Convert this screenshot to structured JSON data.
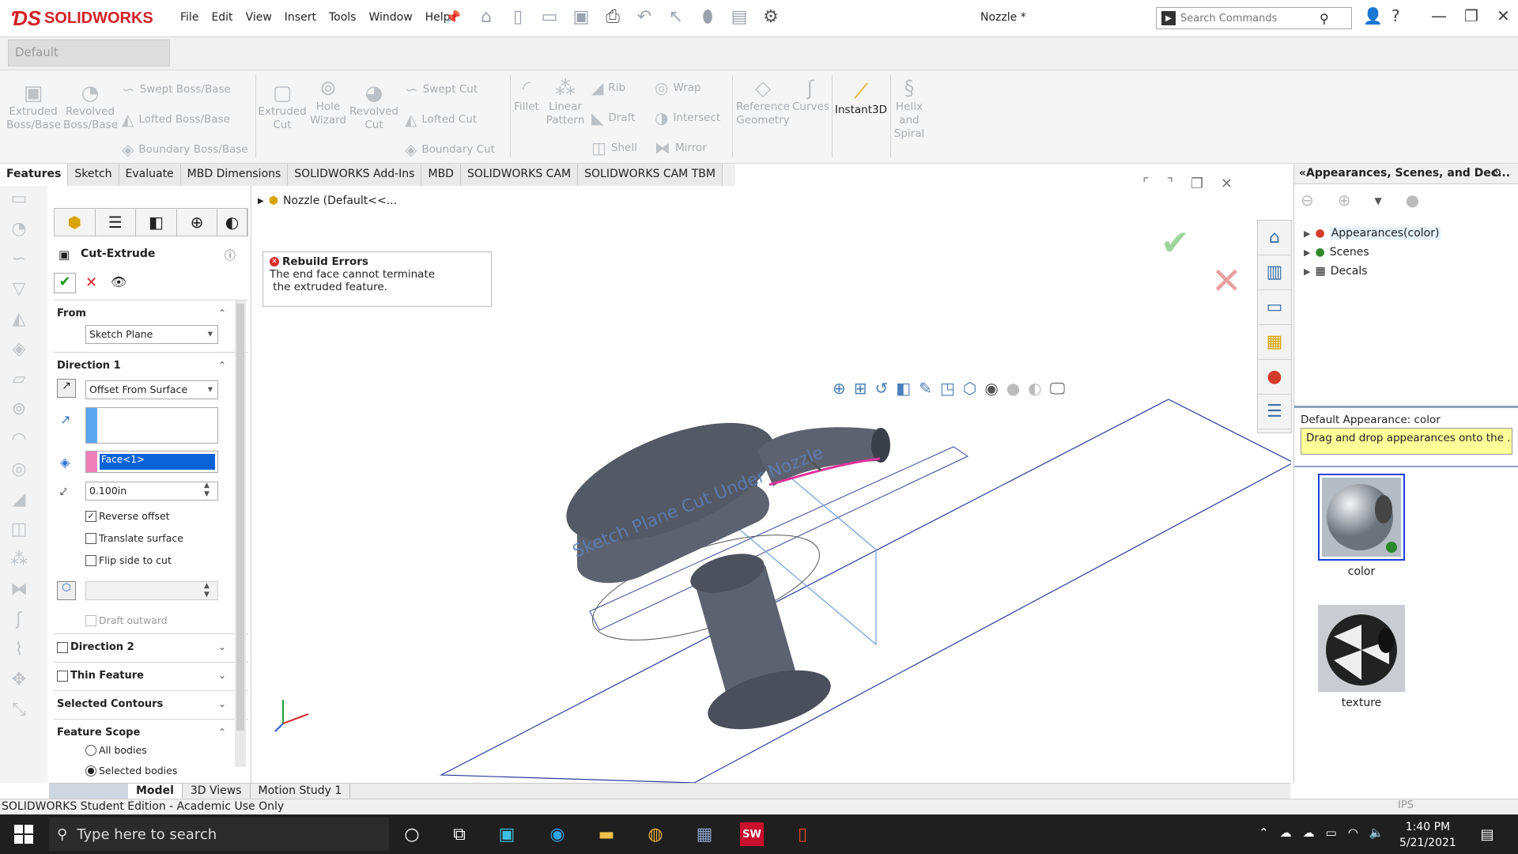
{
  "app": {
    "brand": "SOLIDWORKS",
    "doc_title": "Nozzle *"
  },
  "menu": [
    "File",
    "Edit",
    "View",
    "Insert",
    "Tools",
    "Window",
    "Help"
  ],
  "search": {
    "placeholder": "Search Commands"
  },
  "config": {
    "value": "Default"
  },
  "ribbon": {
    "extruded_boss": "Extruded\nBoss/Base",
    "revolved_boss": "Revolved\nBoss/Base",
    "swept_boss": "Swept Boss/Base",
    "lofted_boss": "Lofted Boss/Base",
    "boundary_boss": "Boundary Boss/Base",
    "extruded_cut": "Extruded\nCut",
    "hole_wizard": "Hole\nWizard",
    "revolved_cut": "Revolved\nCut",
    "swept_cut": "Swept Cut",
    "lofted_cut": "Lofted Cut",
    "boundary_cut": "Boundary Cut",
    "fillet": "Fillet",
    "linear_pattern": "Linear\nPattern",
    "rib": "Rib",
    "draft": "Draft",
    "shell": "Shell",
    "wrap": "Wrap",
    "intersect": "Intersect",
    "mirror": "Mirror",
    "reference_geometry": "Reference\nGeometry",
    "curves": "Curves",
    "instant3d": "Instant3D",
    "helix": "Helix\nand\nSpiral"
  },
  "tabs": [
    "Features",
    "Sketch",
    "Evaluate",
    "MBD Dimensions",
    "SOLIDWORKS Add-Ins",
    "MBD",
    "SOLIDWORKS CAM",
    "SOLIDWORKS CAM TBM"
  ],
  "property_manager": {
    "title": "Cut-Extrude",
    "from_label": "From",
    "from_value": "Sketch Plane",
    "direction1_label": "Direction 1",
    "direction1_value": "Offset From Surface",
    "face_value": "Face<1>",
    "offset_value": "0.100in",
    "reverse_offset": "Reverse offset",
    "translate_surface": "Translate surface",
    "flip_side": "Flip side to cut",
    "draft_outward": "Draft outward",
    "direction2": "Direction 2",
    "thin_feature": "Thin Feature",
    "selected_contours": "Selected Contours",
    "feature_scope": "Feature Scope",
    "all_bodies": "All bodies",
    "selected_bodies": "Selected bodies"
  },
  "viewport": {
    "breadcrumb": "Nozzle  (Default<<...",
    "error_title": "Rebuild Errors",
    "error_line1": "The end face cannot terminate",
    "error_line2": " the extruded feature.",
    "sketch_text": "Sketch Plane Cut Under Nozzle"
  },
  "right_panel": {
    "title": "Appearances, Scenes, and Dec...",
    "tree": [
      "Appearances(color)",
      "Scenes",
      "Decals"
    ],
    "default_appearance": "Default Appearance: color",
    "tooltip": "Drag and drop appearances onto the ...",
    "thumbs": [
      "color",
      "texture"
    ]
  },
  "bottom_tabs": [
    "Model",
    "3D Views",
    "Motion Study 1"
  ],
  "status": {
    "text": "SOLIDWORKS Student Edition - Academic Use Only",
    "units": "IPS"
  },
  "taskbar": {
    "search_placeholder": "Type here to search",
    "time": "1:40 PM",
    "date": "5/21/2021"
  }
}
